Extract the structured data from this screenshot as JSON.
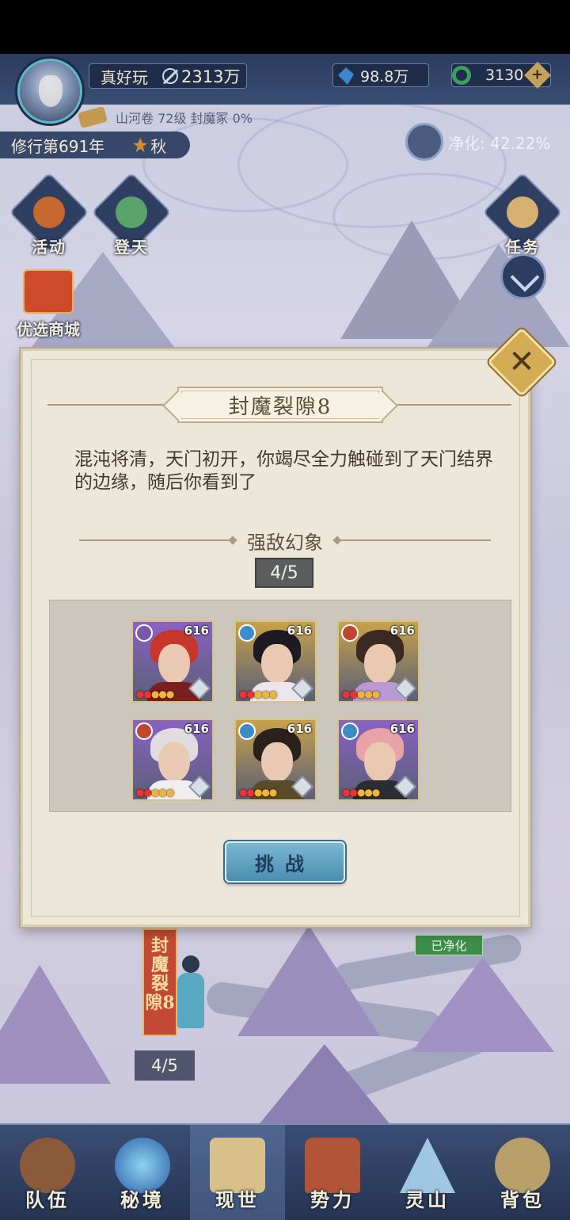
{
  "header": {
    "player_name": "真好玩",
    "power": "2313万",
    "resource_gems": "98.8万",
    "resource_jade": "3130",
    "sub_info": "山河卷 72级 封魔冢 0%",
    "cultivation_year": "修行第691年",
    "season": "秋",
    "purify_label": "净化: 42.22%"
  },
  "side_buttons": {
    "activity": "活动",
    "ascend": "登天",
    "task": "任务",
    "shop": "优选商城"
  },
  "dialog": {
    "title": "封魔裂隙8",
    "description": "混沌将清，天门初开，你竭尽全力触碰到了天门结界的边缘，随后你看到了",
    "subtitle": "强敌幻象",
    "counter": "4/5",
    "challenge_label": "挑战",
    "close_icon": "close-icon",
    "heroes": [
      {
        "level": "616",
        "element": "wind",
        "frame_color": "#8a62c4"
      },
      {
        "level": "616",
        "element": "water",
        "frame_color": "#c8a24a"
      },
      {
        "level": "616",
        "element": "fire",
        "frame_color": "#c8a24a"
      },
      {
        "level": "616",
        "element": "fire",
        "frame_color": "#8a62c4"
      },
      {
        "level": "616",
        "element": "water",
        "frame_color": "#c8a24a"
      },
      {
        "level": "616",
        "element": "water",
        "frame_color": "#8a62c4"
      }
    ]
  },
  "map": {
    "rift_banner": "封魔裂隙8",
    "rift_count": "4/5",
    "purified_tag": "已净化"
  },
  "bottom_nav": [
    {
      "label": "队伍",
      "icon": "team-icon"
    },
    {
      "label": "秘境",
      "icon": "secret-realm-icon"
    },
    {
      "label": "现世",
      "icon": "world-icon"
    },
    {
      "label": "势力",
      "icon": "faction-icon"
    },
    {
      "label": "灵山",
      "icon": "spirit-mountain-icon"
    },
    {
      "label": "背包",
      "icon": "backpack-icon"
    }
  ]
}
